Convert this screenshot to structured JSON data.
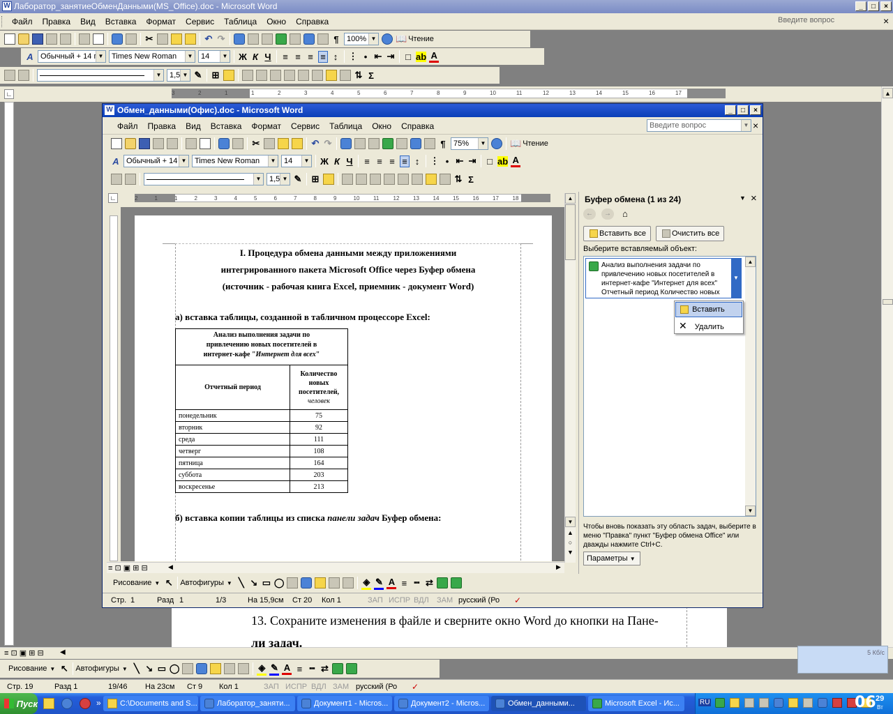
{
  "outer": {
    "title": "Лаборатор_занятиеОбменДанными(MS_Office).doc - Microsoft Word",
    "menu": [
      "Файл",
      "Правка",
      "Вид",
      "Вставка",
      "Формат",
      "Сервис",
      "Таблица",
      "Окно",
      "Справка"
    ],
    "ask_placeholder": "Введите вопрос",
    "zoom": "100%",
    "reading_label": "Чтение",
    "style_combo": "Обычный + 14 г",
    "font_combo": "Times New Roman",
    "size_combo": "14",
    "line_width_combo": "1,5",
    "bold_glyph": "Ж",
    "italic_glyph": "К",
    "underline_glyph": "Ч",
    "ruler_numbers": [
      "3",
      "2",
      "1",
      "1",
      "2",
      "3",
      "4",
      "5",
      "6",
      "7",
      "8",
      "9",
      "10",
      "11",
      "12",
      "13",
      "14",
      "15",
      "16",
      "17"
    ],
    "doc_text_line1": "13. Сохраните изменения в файле и сверните окно Word до кнопки на Пане-",
    "doc_text_line2": "ли задач.",
    "drawing_label": "Рисование",
    "autoshapes_label": "Автофигуры",
    "status": {
      "page": "Стр. 19",
      "section": "Разд 1",
      "pages": "19/46",
      "at": "На 23см",
      "line": "Ст 9",
      "col": "Кол 1",
      "rec": "ЗАП",
      "trk": "ИСПР",
      "ext": "ВДЛ",
      "ovr": "ЗАМ",
      "lang": "русский (Ро"
    },
    "corner_indicator": "5 Кб/с"
  },
  "inner": {
    "title": "Обмен_данными(Офис).doc - Microsoft Word",
    "menu": [
      "Файл",
      "Правка",
      "Вид",
      "Вставка",
      "Формат",
      "Сервис",
      "Таблица",
      "Окно",
      "Справка"
    ],
    "ask_placeholder": "Введите вопрос",
    "zoom": "75%",
    "reading_label": "Чтение",
    "style_combo": "Обычный + 14 г",
    "font_combo": "Times New Roman",
    "size_combo": "14",
    "line_width_combo": "1,5",
    "ruler_numbers": [
      "2",
      "1",
      "1",
      "2",
      "3",
      "4",
      "5",
      "6",
      "7",
      "8",
      "9",
      "10",
      "11",
      "12",
      "13",
      "14",
      "15",
      "16",
      "17",
      "18"
    ],
    "doc": {
      "heading_lines": [
        "I. Процедура обмена данными между приложениями",
        "интегрированного пакета Microsoft Office через Буфер обмена",
        "(источник - рабочая книга Excel, приемник - документ Word)"
      ],
      "section_a": "а) вставка таблицы, созданной в табличном процессоре Excel:",
      "table_title_line1": "Анализ выполнения задачи по",
      "table_title_line2": "привлечению новых посетителей в",
      "table_title_line3_plain": "интернет-кафе \"",
      "table_title_line3_italic": "Интернет для всех",
      "table_title_line3_end": "\"",
      "col1_header": "Отчетный период",
      "col2_header_lines": [
        "Количество",
        "новых",
        "посетителей,"
      ],
      "col2_header_unit": "человек",
      "rows": [
        {
          "day": "понедельник",
          "value": "75"
        },
        {
          "day": "вторник",
          "value": "92"
        },
        {
          "day": "среда",
          "value": "111"
        },
        {
          "day": "четверг",
          "value": "108"
        },
        {
          "day": "пятница",
          "value": "164"
        },
        {
          "day": "суббота",
          "value": "203"
        },
        {
          "day": "воскресенье",
          "value": "213"
        }
      ],
      "section_b_prefix": "б) вставка копии таблицы из списка ",
      "section_b_italic": "панели задач",
      "section_b_suffix": " Буфер обмена:"
    },
    "clipboard": {
      "title": "Буфер обмена (1 из 24)",
      "paste_all": "Вставить все",
      "clear_all": "Очистить все",
      "choose_label": "Выберите вставляемый объект:",
      "item_text": "Анализ выполнения задачи по привлечению новых посетителей в интернет-кафе \"Интернет для всех\" Отчетный период Количество новых",
      "menu_paste": "Вставить",
      "menu_delete": "Удалить",
      "hint": "Чтобы вновь показать эту область задач, выберите в меню \"Правка\" пункт \"Буфер обмена Office\" или дважды нажмите Ctrl+C.",
      "options_button": "Параметры"
    },
    "drawing_label": "Рисование",
    "autoshapes_label": "Автофигуры",
    "status": {
      "page": "Стр.",
      "page_num": "1",
      "section": "Разд",
      "section_num": "1",
      "pages": "1/3",
      "at": "На 15,9см",
      "line": "Ст 20",
      "col": "Кол 1",
      "rec": "ЗАП",
      "trk": "ИСПР",
      "ext": "ВДЛ",
      "ovr": "ЗАМ",
      "lang": "русский (Ро"
    }
  },
  "taskbar": {
    "start": "Пуск",
    "buttons": [
      {
        "label": "C:\\Documents and S...",
        "active": false
      },
      {
        "label": "Лаборатор_заняти...",
        "active": false
      },
      {
        "label": "Документ1 - Micros...",
        "active": false
      },
      {
        "label": "Документ2 - Micros...",
        "active": false
      },
      {
        "label": "Обмен_данными...",
        "active": true
      },
      {
        "label": "Microsoft Excel - Ис...",
        "active": false
      }
    ],
    "lang": "RU",
    "clock": "06",
    "clock_minutes": "29",
    "clock_day": "Вт"
  },
  "colors": {
    "xp_blue": "#0a3fb8",
    "xp_face": "#ece9d8",
    "taskbar": "#245edb",
    "start_green": "#3c9a3c"
  }
}
